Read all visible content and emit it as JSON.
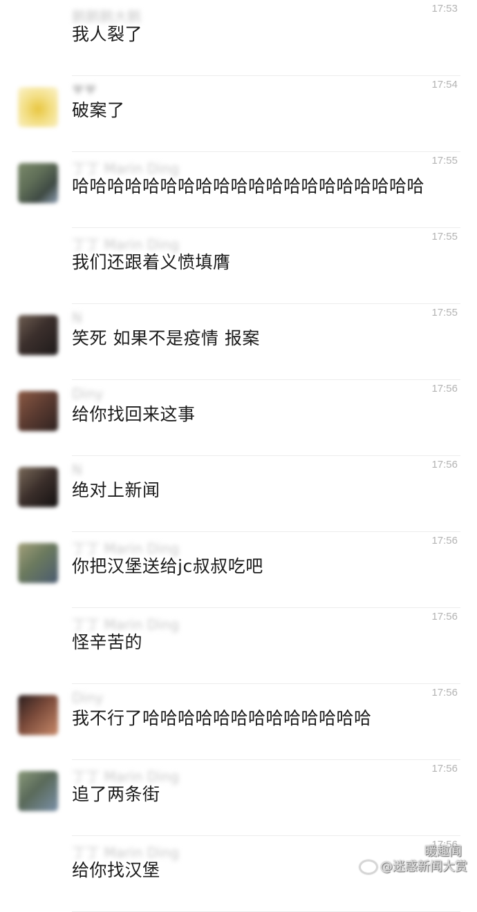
{
  "messages": [
    {
      "name": "鹅鹅鹅大鹅",
      "time": "17:53",
      "text": "我人裂了",
      "avatar": ""
    },
    {
      "name": "♥♥",
      "time": "17:54",
      "text": "破案了",
      "avatar": "av-yellow"
    },
    {
      "name": "丁丁 Marin Ding",
      "time": "17:55",
      "text": "哈哈哈哈哈哈哈哈哈哈哈哈哈哈哈哈哈哈哈哈",
      "avatar": "av-green"
    },
    {
      "name": "丁丁 Marin Ding",
      "time": "17:55",
      "text": "我们还跟着义愤填膺",
      "avatar": ""
    },
    {
      "name": "N",
      "time": "17:55",
      "text": "笑死 如果不是疫情 报案",
      "avatar": "av-dark1"
    },
    {
      "name": "Diny",
      "time": "17:56",
      "text": "给你找回来这事",
      "avatar": "av-brown"
    },
    {
      "name": "N",
      "time": "17:56",
      "text": "绝对上新闻",
      "avatar": "av-dark2"
    },
    {
      "name": "丁丁 Marin Ding",
      "time": "17:56",
      "text": "你把汉堡送给jc叔叔吃吧",
      "avatar": "av-green2"
    },
    {
      "name": "丁丁 Marin Ding",
      "time": "17:56",
      "text": "怪辛苦的",
      "avatar": ""
    },
    {
      "name": "Diny",
      "time": "17:56",
      "text": "我不行了哈哈哈哈哈哈哈哈哈哈哈哈哈",
      "avatar": "av-red"
    },
    {
      "name": "丁丁 Marin Ding",
      "time": "17:56",
      "text": "追了两条街",
      "avatar": "av-green3"
    },
    {
      "name": "丁丁 Marin Ding",
      "time": "17:56",
      "text": "给你找汉堡",
      "avatar": ""
    }
  ],
  "watermark": {
    "top": "暖趣闻",
    "bottom": "@迷惑新闻大赏",
    "icon": "weibo-icon"
  }
}
